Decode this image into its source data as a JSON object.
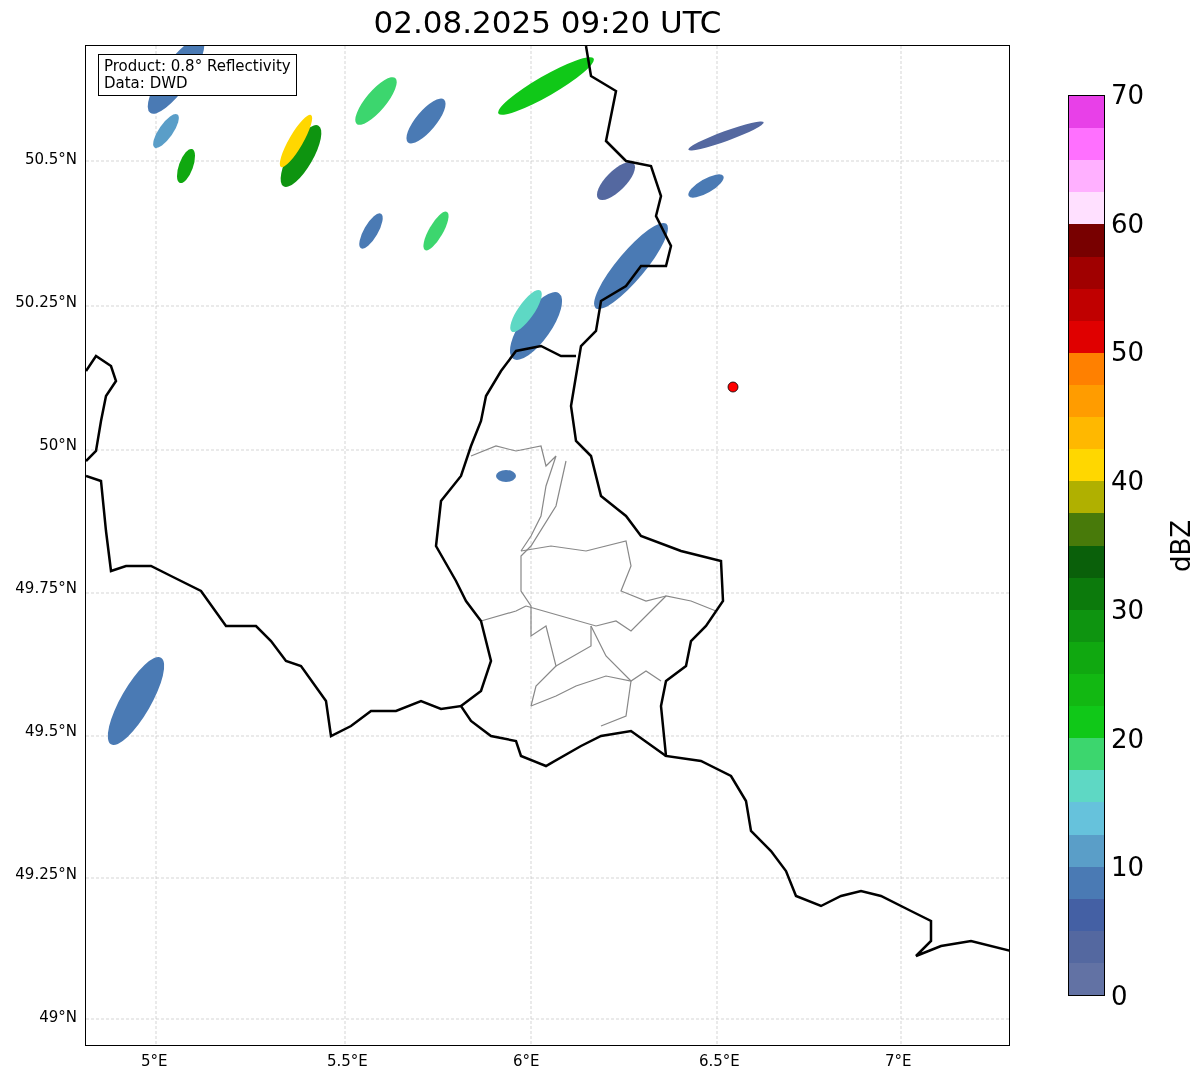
{
  "title": "02.08.2025 09:20 UTC",
  "info": {
    "lines": [
      "Product: 0.8° Reflectivity",
      "Data: DWD"
    ]
  },
  "y_ticks": [
    "50.5°N",
    "50.25°N",
    "50°N",
    "49.75°N",
    "49.5°N",
    "49.25°N",
    "49°N"
  ],
  "x_ticks": [
    "5°E",
    "5.5°E",
    "6°E",
    "6.5°E",
    "7°E"
  ],
  "colorbar": {
    "label": "dBZ",
    "ticks": [
      "70",
      "60",
      "50",
      "40",
      "30",
      "20",
      "10",
      "0"
    ],
    "bands": [
      {
        "color": "#e840e8"
      },
      {
        "color": "#ff70ff"
      },
      {
        "color": "#ffb0ff"
      },
      {
        "color": "#ffe0ff"
      },
      {
        "color": "#780000"
      },
      {
        "color": "#a00000"
      },
      {
        "color": "#c00000"
      },
      {
        "color": "#e00000"
      },
      {
        "color": "#ff8000"
      },
      {
        "color": "#ff9c00"
      },
      {
        "color": "#ffb800"
      },
      {
        "color": "#ffd700"
      },
      {
        "color": "#b0b000"
      },
      {
        "color": "#487a0a"
      },
      {
        "color": "#0a600a"
      },
      {
        "color": "#0c7a0c"
      },
      {
        "color": "#0e9410"
      },
      {
        "color": "#10a810"
      },
      {
        "color": "#12b812"
      },
      {
        "color": "#10c818"
      },
      {
        "color": "#3cd66e"
      },
      {
        "color": "#5ed8c4"
      },
      {
        "color": "#66c2dc"
      },
      {
        "color": "#5a9ec8"
      },
      {
        "color": "#4a7ab4"
      },
      {
        "color": "#4460a4"
      },
      {
        "color": "#5468a0"
      },
      {
        "color": "#6272a4"
      }
    ]
  }
}
